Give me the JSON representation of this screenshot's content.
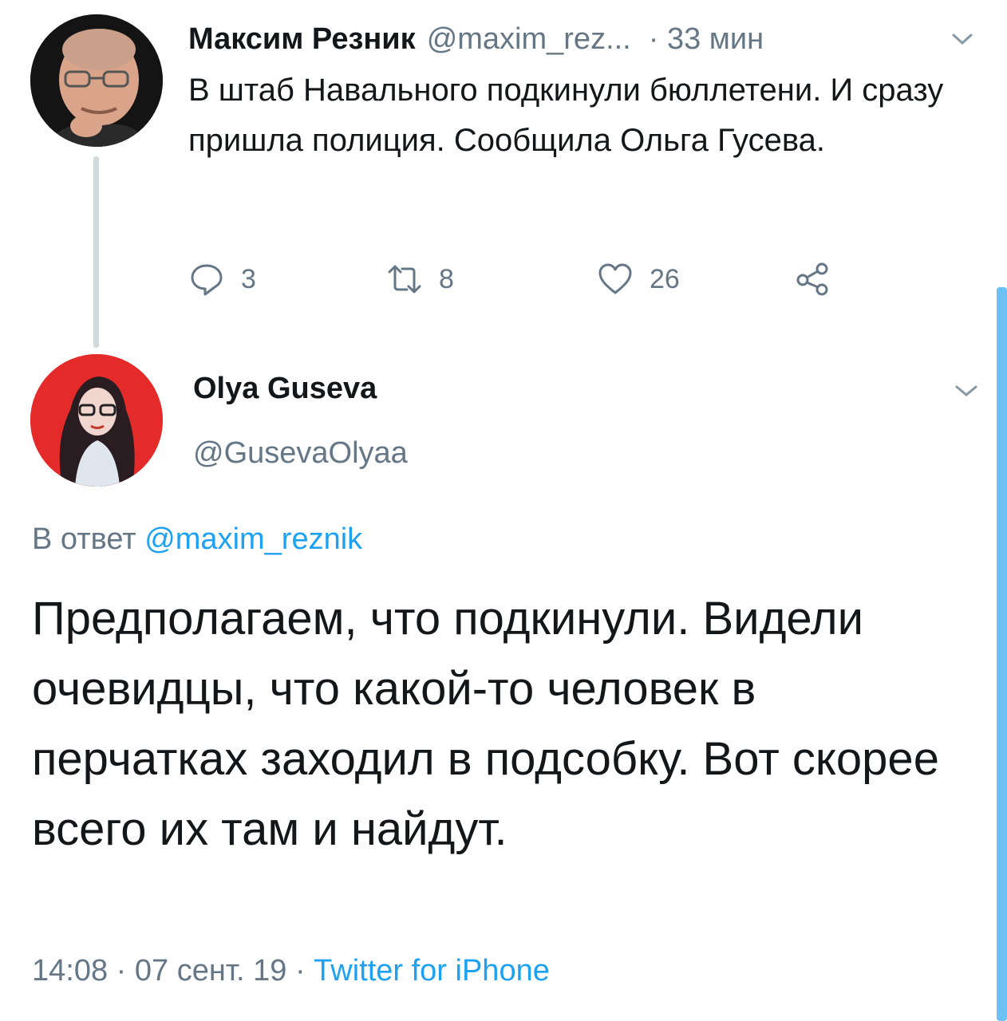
{
  "parent_tweet": {
    "author_name": "Максим Резник",
    "handle": "@maxim_rez...",
    "time": "· 33 мин",
    "text": "В штаб Навального подкинули бюллетени. И сразу пришла полиция. Сообщила Ольга Гусева.",
    "actions": {
      "reply_count": "3",
      "retweet_count": "8",
      "like_count": "26"
    }
  },
  "reply_tweet": {
    "author_name": "Olya Guseva",
    "handle": "@GusevaOlyaa",
    "reply_prefix": "В ответ ",
    "reply_mention": "@maxim_reznik",
    "text": "Предполагаем, что подкинули. Видели очевидцы, что какой-то человек в перчатках заходил в подсобку. Вот скорее всего их там и найдут.",
    "meta_time": "14:08 · 07 сент. 19 · ",
    "source": "Twitter for iPhone"
  },
  "colors": {
    "text": "#14171a",
    "secondary": "#657786",
    "link": "#1da1f2",
    "thread_line": "#cfd9de",
    "avatar_red": "#e52a2a"
  },
  "icons": [
    "reply-icon",
    "retweet-icon",
    "like-icon",
    "share-icon",
    "chevron-down-icon"
  ]
}
